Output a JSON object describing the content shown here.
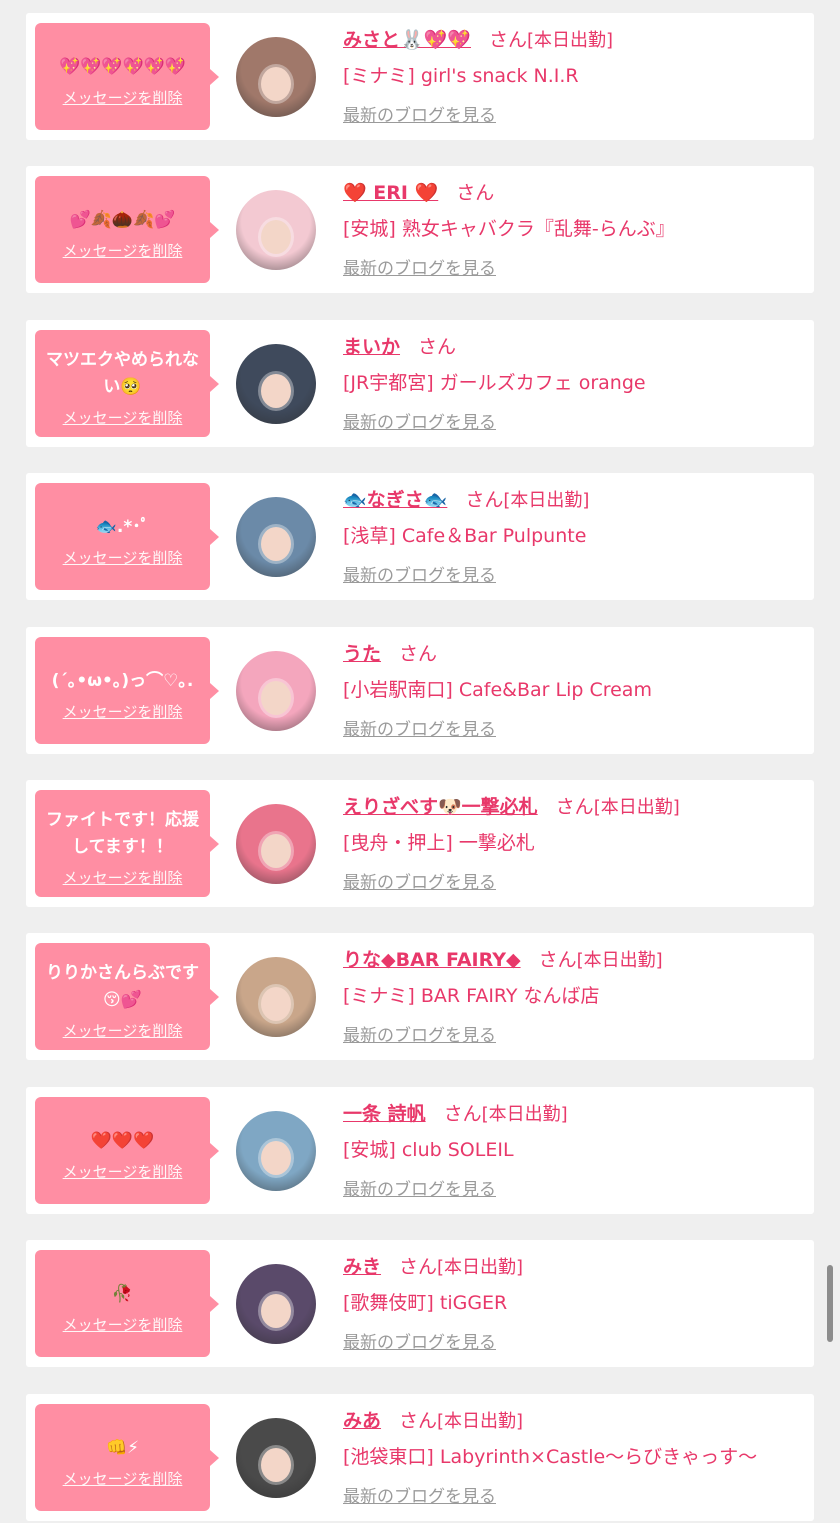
{
  "colors": {
    "accent": "#e8386a",
    "bubble": "#ff8ea3",
    "background": "#efefef"
  },
  "common": {
    "san": "さん",
    "delete_label": "メッセージを削除",
    "blog_label": "最新のブログを見る",
    "today_label": "[本日出勤]"
  },
  "items": [
    {
      "message": "💖💖💖💖💖💖",
      "name": "みさと🐰💖💖",
      "working_today": true,
      "shop": "[ミナミ] girl's snack N.I.R",
      "avatar_color": "#a0786a"
    },
    {
      "message": "💕🍂🌰🍂💕",
      "name": "❤️ ERI ❤️",
      "working_today": false,
      "shop": "[安城] 熟女キャバクラ『乱舞-らんぶ』",
      "avatar_color": "#f3c9d2"
    },
    {
      "message": "マツエクやめられない🥺",
      "name": "まいか",
      "working_today": false,
      "shop": "[JR宇都宮] ガールズカフェ orange",
      "avatar_color": "#3f4a5c"
    },
    {
      "message": "🐟.*･ﾟ",
      "name": "🐟なぎさ🐟",
      "working_today": true,
      "shop": "[浅草] Cafe＆Bar Pulpunte",
      "avatar_color": "#6b8aa8"
    },
    {
      "message": "(´｡•ω•｡)っ⌒♡｡.",
      "name": "うた",
      "working_today": false,
      "shop": "[小岩駅南口] Cafe&Bar Lip Cream",
      "avatar_color": "#f4a6bd"
    },
    {
      "message": "ファイトです！応援してます！！",
      "name": "えりざべす🐶一撃必札",
      "working_today": true,
      "shop": "[曳舟・押上] 一撃必札",
      "avatar_color": "#e9748c"
    },
    {
      "message": "りりかさんらぶです😚💕",
      "name": "りな◆BAR FAIRY◆",
      "working_today": true,
      "shop": "[ミナミ] BAR FAIRY なんば店",
      "avatar_color": "#c9a68a"
    },
    {
      "message": "❤️❤️❤️",
      "name": "一条 詩帆",
      "working_today": true,
      "shop": "[安城] club SOLEIL",
      "avatar_color": "#7fa7c4"
    },
    {
      "message": "🥀",
      "name": "みき",
      "working_today": true,
      "shop": "[歌舞伎町] tiGGER",
      "avatar_color": "#5a4a6a"
    },
    {
      "message": "👊⚡",
      "name": "みあ",
      "working_today": true,
      "shop": "[池袋東口] Labyrinth×Castle〜らびきゃっす〜",
      "avatar_color": "#4a4a4a"
    }
  ]
}
